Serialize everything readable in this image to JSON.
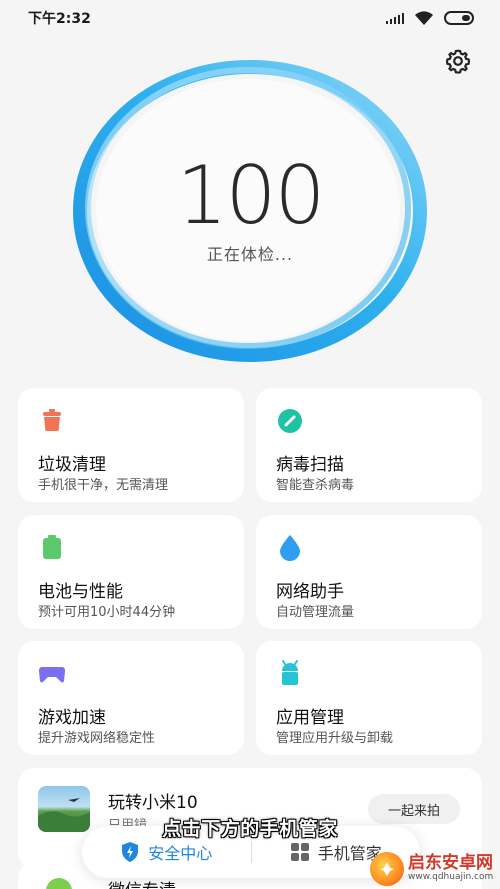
{
  "status_bar": {
    "time": "下午2:32"
  },
  "header": {
    "settings_icon": "gear-icon"
  },
  "score": {
    "value": "100",
    "status": "正在体检..."
  },
  "cards": [
    {
      "title": "垃圾清理",
      "subtitle": "手机很干净，无需清理",
      "icon": "trash-bin-icon",
      "color": "#f07356"
    },
    {
      "title": "病毒扫描",
      "subtitle": "智能查杀病毒",
      "icon": "virus-scan-icon",
      "color": "#1fc3a3"
    },
    {
      "title": "电池与性能",
      "subtitle": "预计可用10小时44分钟",
      "icon": "battery-icon",
      "color": "#5cc96b"
    },
    {
      "title": "网络助手",
      "subtitle": "自动管理流量",
      "icon": "water-drop-icon",
      "color": "#2f9df0"
    },
    {
      "title": "游戏加速",
      "subtitle": "提升游戏网络稳定性",
      "icon": "gamepad-icon",
      "color": "#7b6ef0"
    },
    {
      "title": "应用管理",
      "subtitle": "管理应用升级与卸载",
      "icon": "android-icon",
      "color": "#25c3d6"
    }
  ],
  "promo": {
    "title": "玩转小米10",
    "subtitle": "只用镜",
    "button": "一起来拍"
  },
  "next_card": {
    "title": "微信专清"
  },
  "bottom_nav": {
    "security_center": "安全中心",
    "phone_manager": "手机管家"
  },
  "caption": "点击下方的手机管家",
  "watermark": {
    "name": "启东安卓网",
    "url": "www.qdhuajin.com"
  },
  "colors": {
    "accent": "#1f86e0",
    "ring_start": "#1e9be8",
    "ring_end": "#7fd0f7",
    "background": "#f5f5f5"
  }
}
